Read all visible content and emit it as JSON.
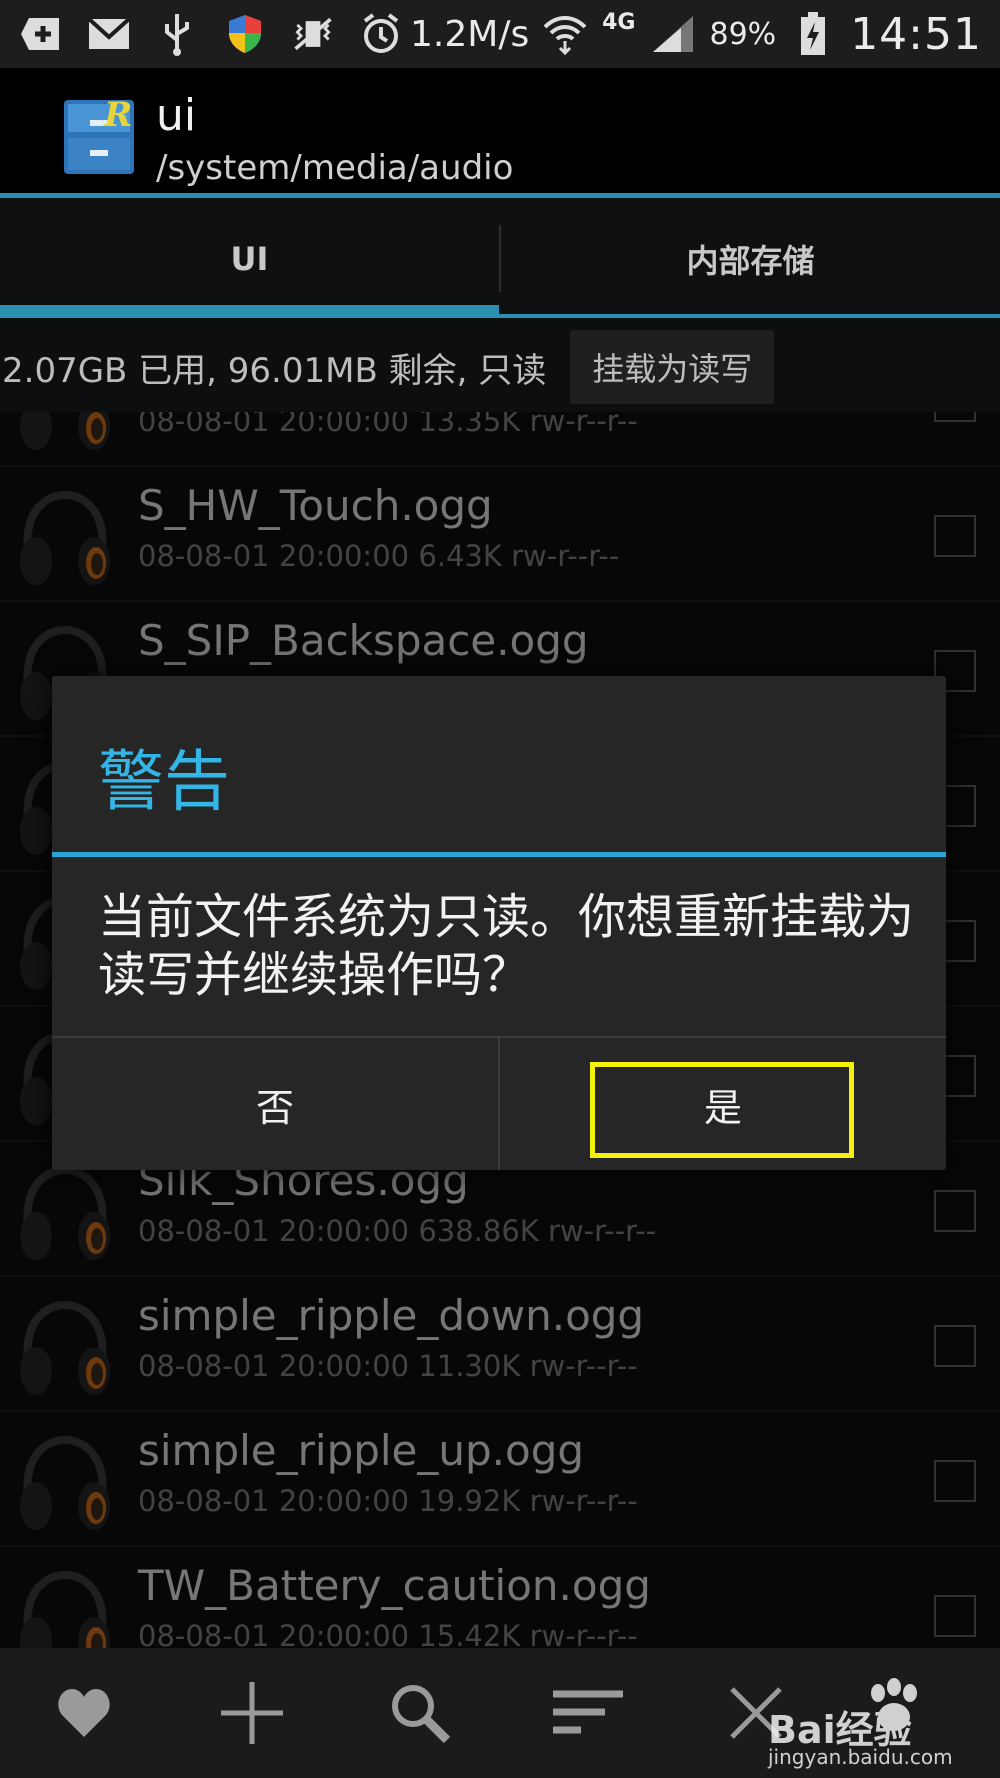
{
  "status_bar": {
    "speed": "1.2M/s",
    "network": "4G",
    "battery": "89%",
    "time": "14:51"
  },
  "app": {
    "title": "ui",
    "path": "/system/media/audio"
  },
  "tabs": [
    {
      "label": "UI",
      "active": true
    },
    {
      "label": "内部存储",
      "active": false
    }
  ],
  "storage": {
    "info": "2.07GB 已用, 96.01MB 剩余, 只读",
    "mount_button": "挂载为读写"
  },
  "files": [
    {
      "name": "",
      "meta": "08-08-01 20:00:00  13.35K  rw-r--r--"
    },
    {
      "name": "S_HW_Touch.ogg",
      "meta": "08-08-01 20:00:00  6.43K  rw-r--r--"
    },
    {
      "name": "S_SIP_Backspace.ogg",
      "meta": ""
    },
    {
      "name": "",
      "meta": ""
    },
    {
      "name": "",
      "meta": ""
    },
    {
      "name": "",
      "meta": ""
    },
    {
      "name": "Silk_Shores.ogg",
      "meta": "08-08-01 20:00:00  638.86K  rw-r--r--"
    },
    {
      "name": "simple_ripple_down.ogg",
      "meta": "08-08-01 20:00:00  11.30K  rw-r--r--"
    },
    {
      "name": "simple_ripple_up.ogg",
      "meta": "08-08-01 20:00:00  19.92K  rw-r--r--"
    },
    {
      "name": "TW_Battery_caution.ogg",
      "meta": "08-08-01 20:00:00  15.42K  rw-r--r--"
    }
  ],
  "dialog": {
    "title": "警告",
    "message": "当前文件系统为只读。你想重新挂载为读写并继续操作吗？",
    "no_label": "否",
    "yes_label": "是"
  },
  "watermark": {
    "brand": "Bai经验",
    "url": "jingyan.baidu.com"
  },
  "colors": {
    "accent": "#33b5e5",
    "highlight": "#f4f10a"
  }
}
